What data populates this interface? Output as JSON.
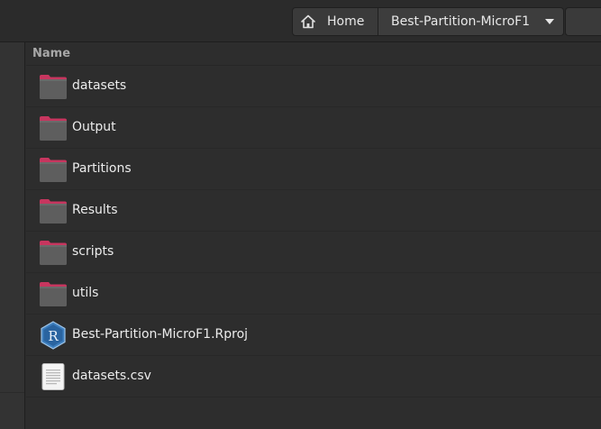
{
  "header": {
    "breadcrumbs": [
      {
        "label": "Home",
        "icon": "home-icon"
      },
      {
        "label": "Best-Partition-MicroF1",
        "icon": "chevron-down-icon"
      }
    ]
  },
  "file_list": {
    "columns": [
      {
        "label": "Name"
      }
    ],
    "items": [
      {
        "name": "datasets",
        "type": "folder",
        "icon": "folder-icon"
      },
      {
        "name": "Output",
        "type": "folder",
        "icon": "folder-icon"
      },
      {
        "name": "Partitions",
        "type": "folder",
        "icon": "folder-icon"
      },
      {
        "name": "Results",
        "type": "folder",
        "icon": "folder-icon"
      },
      {
        "name": "scripts",
        "type": "folder",
        "icon": "folder-icon"
      },
      {
        "name": "utils",
        "type": "folder",
        "icon": "folder-icon"
      },
      {
        "name": "Best-Partition-MicroF1.Rproj",
        "type": "rproj",
        "icon": "r-project-icon"
      },
      {
        "name": "datasets.csv",
        "type": "text",
        "icon": "text-file-icon"
      }
    ]
  },
  "colors": {
    "folder_tab": "#c7365f",
    "folder_body": "#5d5d5d",
    "background": "#2d2d2d",
    "text": "#ececec"
  }
}
